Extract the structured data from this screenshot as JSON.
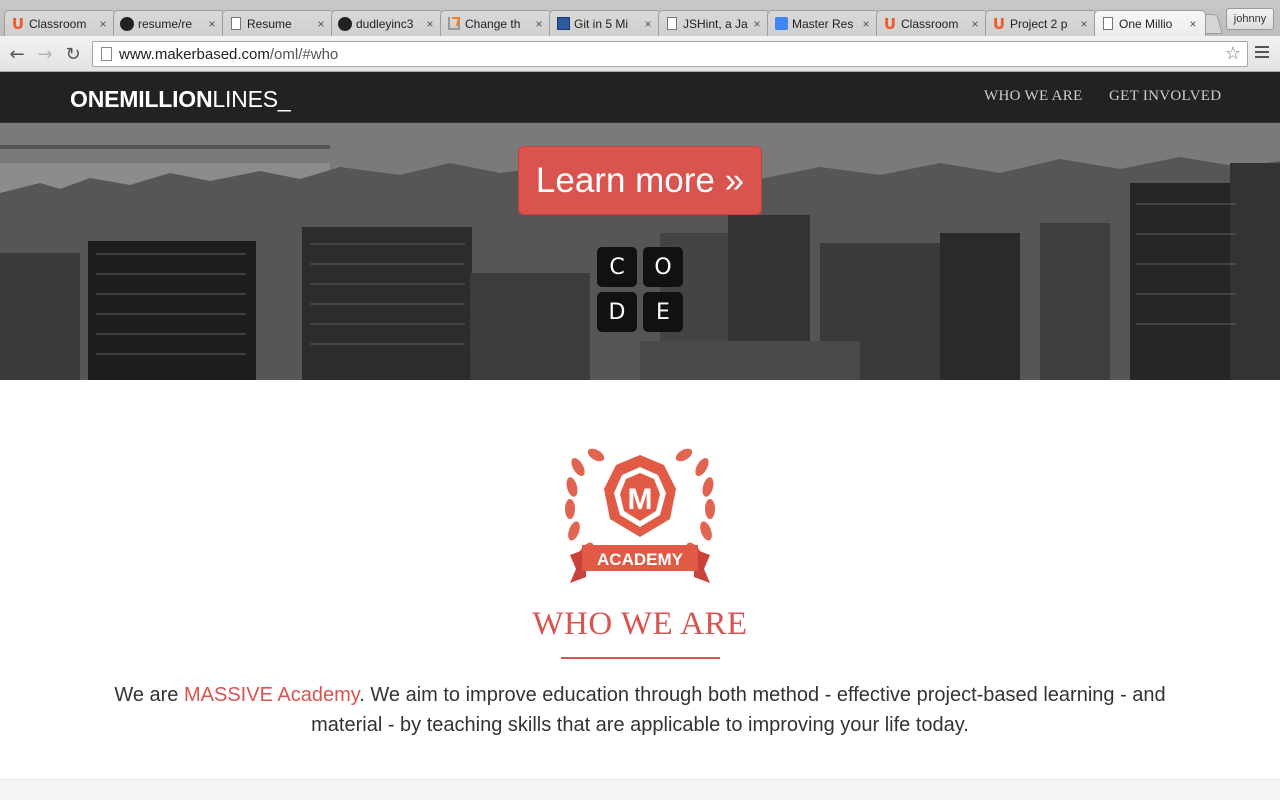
{
  "browser": {
    "tabs": [
      {
        "title": "Classroom",
        "favicon": "udacity-icon",
        "active": false
      },
      {
        "title": "resume/re",
        "favicon": "github-icon",
        "active": false
      },
      {
        "title": "Resume",
        "favicon": "document-icon",
        "active": false
      },
      {
        "title": "dudleyinc3",
        "favicon": "github-icon",
        "active": false
      },
      {
        "title": "Change th",
        "favicon": "stackoverflow-icon",
        "active": false
      },
      {
        "title": "Git in 5 Mi",
        "favicon": "git-icon",
        "active": false
      },
      {
        "title": "JSHint, a Ja",
        "favicon": "document-icon",
        "active": false
      },
      {
        "title": "Master Res",
        "favicon": "google-docs-icon",
        "active": false
      },
      {
        "title": "Classroom",
        "favicon": "udacity-icon",
        "active": false
      },
      {
        "title": "Project 2 p",
        "favicon": "udacity-icon",
        "active": false
      },
      {
        "title": "One Millio",
        "favicon": "document-icon",
        "active": true
      }
    ],
    "profile_name": "johnny",
    "url_host": "www.makerbased.com",
    "url_path": "/oml/#who",
    "tab_close_glyph": "×"
  },
  "site": {
    "brand_bold": "ONEMILLION",
    "brand_light": "LINES_",
    "nav": [
      {
        "label": "WHO WE ARE"
      },
      {
        "label": "GET INVOLVED"
      }
    ]
  },
  "hero": {
    "button_label": "Learn more »",
    "code_tiles": [
      "C",
      "O",
      "D",
      "E"
    ]
  },
  "who": {
    "logo_letter": "M",
    "logo_banner": "ACADEMY",
    "title": "WHO WE ARE",
    "text_before": "We are ",
    "text_highlight": "MASSIVE Academy",
    "text_after": ". We aim to improve education through both method - effective project-based learning - and material - by teaching skills that are applicable to improving your life today."
  },
  "colors": {
    "accent": "#d9534f",
    "navbar": "#222222"
  }
}
